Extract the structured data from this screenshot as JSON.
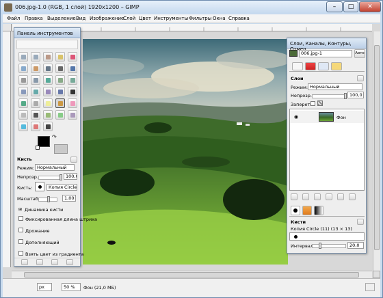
{
  "window": {
    "title": "006.jpg-1.0 (RGB, 1 слой) 1920x1200 – GIMP",
    "min_glyph": "–",
    "max_glyph": "□",
    "close_glyph": "✕"
  },
  "menubar": [
    "Файл",
    "Правка",
    "Выделение",
    "Вид",
    "Изображение",
    "Слой",
    "Цвет",
    "Инструменты",
    "Фильтры",
    "Окна",
    "Справка"
  ],
  "toolbox": {
    "title": "Панель инструментов",
    "brush_options": {
      "heading": "Кисть",
      "mode_label": "Режим:",
      "mode_value": "Нормальный",
      "opacity_label": "Непрозр.:",
      "opacity_value": "100,0",
      "opacity_fraction": 1.0,
      "brush_label": "Кисть:",
      "brush_value": "Копия Circle (11)",
      "scale_label": "Масштаб:",
      "scale_value": "1,00",
      "dynamics_label": "Динамика кисти",
      "fixed_label": "Фиксированная длина штриха",
      "jitter_label": "Дрожание",
      "incremental_label": "Дополняющий",
      "gradient_label": "Взять цвет из градиента"
    }
  },
  "layers_panel": {
    "title": "Слои, Каналы, Контуры, Отмен...",
    "image_name": "006.jpg-1",
    "auto_label": "Авто",
    "tab_title": "Слои",
    "mode_label": "Режим:",
    "mode_value": "Нормальный",
    "opacity_label": "Непрозр.:",
    "opacity_value": "100,0",
    "lock_label": "Запереть:",
    "layer_name": "Фон"
  },
  "brushes_panel": {
    "tab_title": "Кисти",
    "selected_brush": "Копия Circle (11) (13 × 13)",
    "spacing_label": "Интервал:",
    "spacing_value": "20,0",
    "spacing_fraction": 0.2
  },
  "statusbar": {
    "unit": "px",
    "zoom": "50 %",
    "info": "Фон (21,0 МБ)"
  }
}
